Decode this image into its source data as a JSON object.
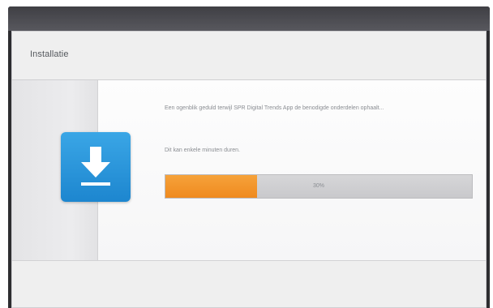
{
  "dialog": {
    "title": "Installatie",
    "message": "Een ogenblik geduld terwijl SPR Digital Trends App de benodigde onderdelen ophaalt...",
    "submessage": "Dit kan enkele minuten duren.",
    "progress": {
      "percent": 30,
      "label": "30%"
    },
    "icon": "download-icon"
  },
  "colors": {
    "icon_blue": "#1d86cf",
    "progress_orange": "#ef8a1f",
    "progress_track": "#c9c9cc"
  }
}
